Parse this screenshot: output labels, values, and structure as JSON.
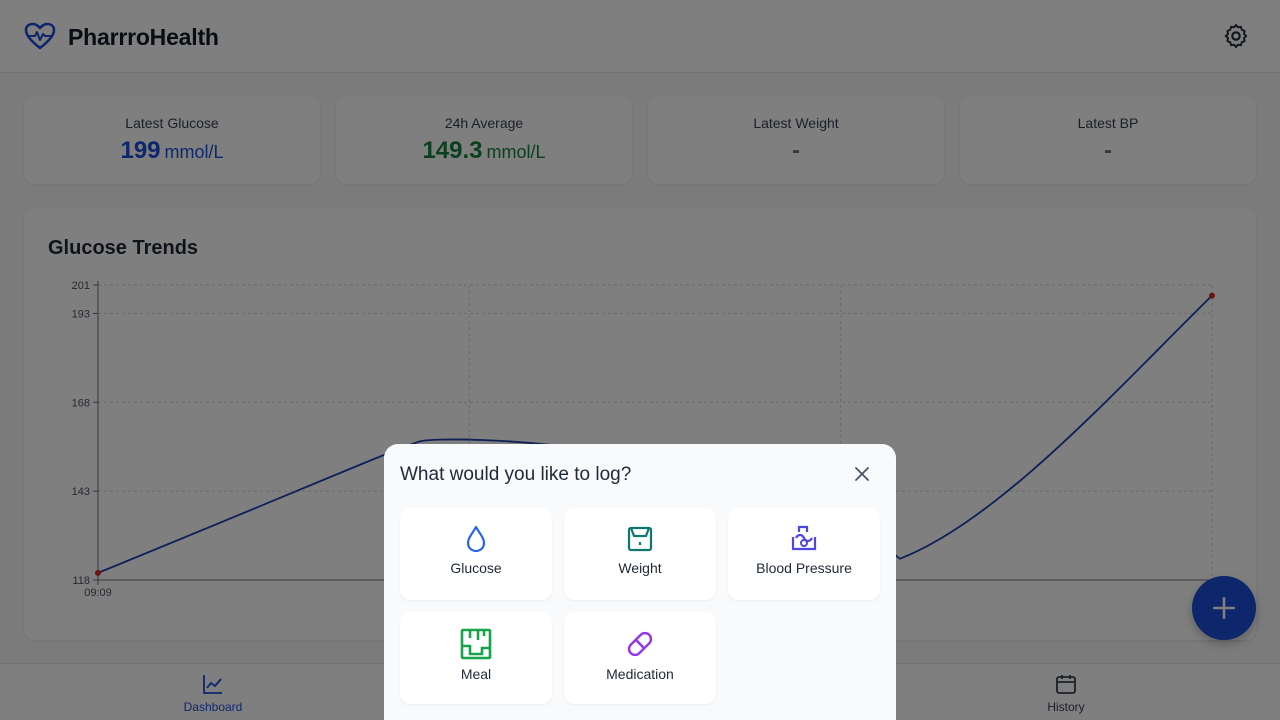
{
  "app": {
    "title": "PharrroHealth"
  },
  "colors": {
    "primary": "#1d4ed8",
    "average": "#15803d",
    "line": "#1e40af",
    "point": "#dc2626",
    "glucose_icon": "#2563eb",
    "weight_icon": "#0f766e",
    "bp_icon": "#4f46e5",
    "meal_icon": "#16a34a",
    "med_icon": "#9333ea"
  },
  "header": {
    "logo_icon": "heart-pulse-icon",
    "settings_icon": "gear-icon"
  },
  "stats": {
    "glucose": {
      "label": "Latest Glucose",
      "value": "199",
      "unit": "mmol/L"
    },
    "average": {
      "label": "24h Average",
      "value": "149.3",
      "unit": "mmol/L"
    },
    "weight": {
      "label": "Latest Weight",
      "value": "-"
    },
    "bp": {
      "label": "Latest BP",
      "value": "-"
    }
  },
  "chart_data": {
    "type": "line",
    "title": "Glucose Trends",
    "y_ticks": [
      118,
      143,
      168,
      193,
      201
    ],
    "x_tick_labels": [
      "09:09"
    ],
    "ylim": [
      118,
      201
    ],
    "grid": true,
    "series": [
      {
        "values": [
          120,
          198
        ]
      }
    ]
  },
  "nav": {
    "items": [
      {
        "label": "Dashboard",
        "icon": "chart-line-icon",
        "active": true
      },
      {
        "label": "History",
        "icon": "calendar-icon",
        "active": false
      }
    ]
  },
  "fab": {
    "icon": "plus-icon"
  },
  "modal": {
    "title": "What would you like to log?",
    "close_icon": "close-icon",
    "options": [
      {
        "label": "Glucose",
        "icon": "droplet-icon"
      },
      {
        "label": "Weight",
        "icon": "scale-icon"
      },
      {
        "label": "Blood Pressure",
        "icon": "blood-pressure-icon"
      },
      {
        "label": "Meal",
        "icon": "meal-icon"
      },
      {
        "label": "Medication",
        "icon": "pill-icon"
      }
    ]
  }
}
